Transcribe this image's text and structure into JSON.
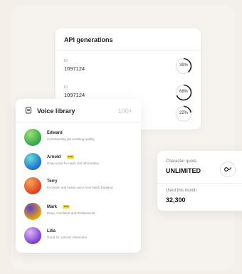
{
  "api": {
    "title": "API generations",
    "rows": [
      {
        "id_label": "ID",
        "id_value": "1097124",
        "percent_label": "39%",
        "percent": 39
      },
      {
        "id_label": "ID",
        "id_value": "1097124",
        "percent_label": "68%",
        "percent": 68
      },
      {
        "id_label": "",
        "id_value": "",
        "percent_label": "22%",
        "percent": 22
      }
    ]
  },
  "voice_library": {
    "title": "Voice library",
    "count": "100+",
    "icon": "book-icon",
    "items": [
      {
        "name": "Edward",
        "description": "Commanding yet soothing quality",
        "badge": "",
        "colors": [
          "#2ea84c",
          "#9fe071"
        ]
      },
      {
        "name": "Arnold",
        "description": "Deep voice for news and information",
        "badge": "PRO",
        "colors": [
          "#1d6fd6",
          "#67e0d0"
        ]
      },
      {
        "name": "Terry",
        "description": "Eccentric and husky voice from North England",
        "badge": "",
        "colors": [
          "#e2401f",
          "#f6a65a"
        ]
      },
      {
        "name": "Mark",
        "description": "Deep, Confident and Professional",
        "badge": "PRO",
        "colors": [
          "#e6a20b",
          "#5c3fd0"
        ]
      },
      {
        "name": "Lilia",
        "description": "Great for cartoon characters",
        "badge": "",
        "colors": [
          "#7b3fd6",
          "#e0b8f5"
        ]
      }
    ]
  },
  "quota": {
    "character_label": "Character quota",
    "character_value": "UNLIMITED",
    "icon": "infinity-icon",
    "used_label": "Used this month",
    "used_value": "32,300"
  }
}
